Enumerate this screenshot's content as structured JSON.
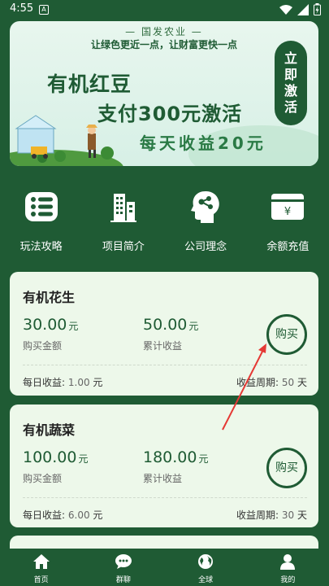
{
  "status": {
    "time": "4:55",
    "badge": "A"
  },
  "banner": {
    "subtitle": "— 国发农业 —",
    "slogan": "让绿色更近一点，让财富更快一点",
    "line1": "有机红豆",
    "line2": "支付300元激活",
    "line3": "每天收益20元",
    "activate": [
      "立",
      "即",
      "激",
      "活"
    ]
  },
  "menu": [
    {
      "label": "玩法攻略",
      "icon": "list-icon"
    },
    {
      "label": "项目简介",
      "icon": "building-icon"
    },
    {
      "label": "公司理念",
      "icon": "head-network-icon"
    },
    {
      "label": "余额充值",
      "icon": "wallet-yen-icon"
    }
  ],
  "products": [
    {
      "name": "有机花生",
      "price": "30.00",
      "price_unit": "元",
      "price_label": "购买金额",
      "income": "50.00",
      "income_unit": "元",
      "income_label": "累计收益",
      "buy": "购买",
      "daily_label": "每日收益:",
      "daily": "1.00",
      "daily_unit": "元",
      "period_label": "收益周期:",
      "period": "50",
      "period_unit": "天"
    },
    {
      "name": "有机蔬菜",
      "price": "100.00",
      "price_unit": "元",
      "price_label": "购买金额",
      "income": "180.00",
      "income_unit": "元",
      "income_label": "累计收益",
      "buy": "购买",
      "daily_label": "每日收益:",
      "daily": "6.00",
      "daily_unit": "元",
      "period_label": "收益周期:",
      "period": "30",
      "period_unit": "天"
    }
  ],
  "tabs": [
    {
      "label": "首页",
      "icon": "home-icon"
    },
    {
      "label": "群聊",
      "icon": "chat-icon"
    },
    {
      "label": "全球",
      "icon": "globe-icon"
    },
    {
      "label": "我的",
      "icon": "user-icon"
    }
  ],
  "colors": {
    "primary": "#1f5b34",
    "card": "#edf8ea",
    "annotation": "#e53935"
  }
}
